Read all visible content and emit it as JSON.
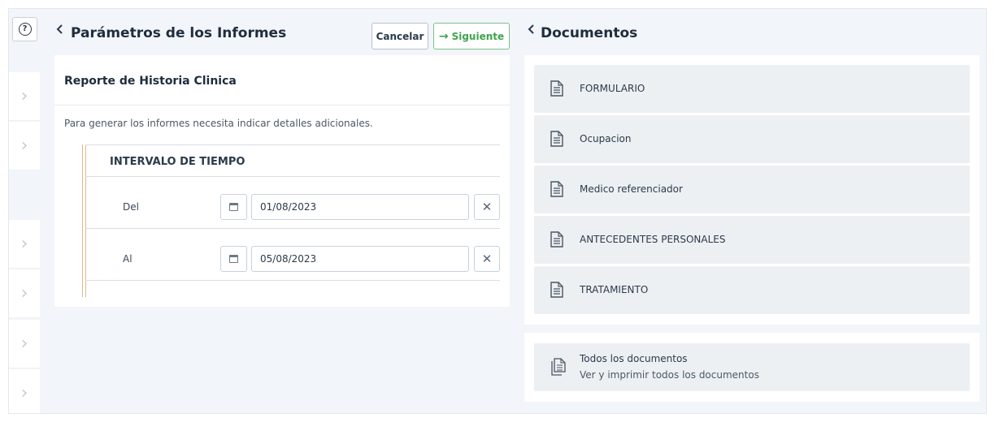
{
  "left_panel": {
    "title": "Parámetros de los Informes",
    "cancel_label": "Cancelar",
    "next_label": "Siguiente",
    "report_title": "Reporte de Historia Clinica",
    "description": "Para generar los informes necesita indicar detalles adicionales.",
    "section_title": "INTERVALO DE TIEMPO",
    "from_label": "Del",
    "from_value": "01/08/2023",
    "to_label": "Al",
    "to_value": "05/08/2023"
  },
  "right_panel": {
    "title": "Documentos",
    "documents": [
      {
        "label": "FORMULARIO"
      },
      {
        "label": "Ocupacion"
      },
      {
        "label": "Medico referenciador"
      },
      {
        "label": "ANTECEDENTES PERSONALES"
      },
      {
        "label": "TRATAMIENTO"
      }
    ],
    "all_docs_title": "Todos los documentos",
    "all_docs_subtitle": "Ver y imprimir todos los documentos"
  },
  "icons": {
    "help": "question-circle-icon",
    "back": "chevron-left-icon",
    "rail": "chevron-right-icon",
    "calendar": "calendar-icon",
    "clear": "close-icon",
    "document": "document-icon",
    "documents": "documents-stack-icon",
    "next": "arrow-right-icon"
  },
  "colors": {
    "accent_green": "#3fa34d",
    "timeline_bar": "#d9b98a"
  }
}
